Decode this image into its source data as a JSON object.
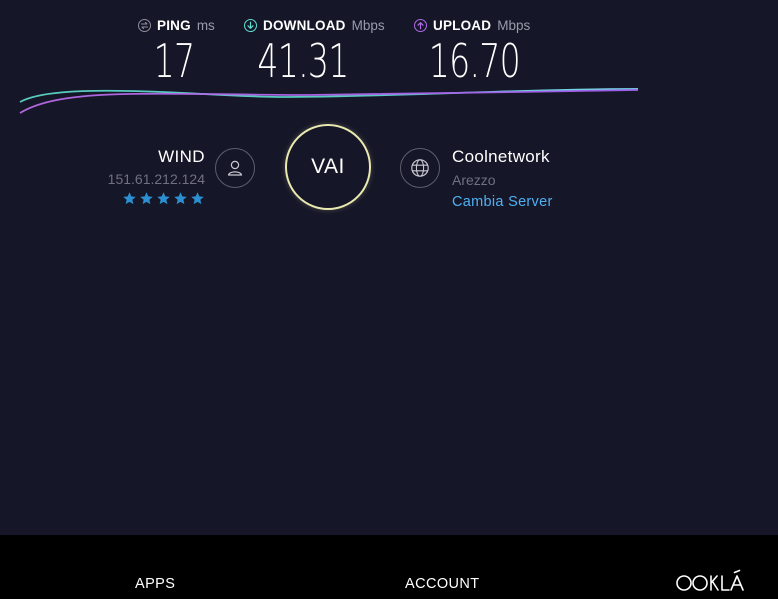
{
  "metrics": {
    "ping": {
      "label": "PING",
      "unit": "ms",
      "value": "17",
      "icon": "ping-icon"
    },
    "download": {
      "label": "DOWNLOAD",
      "unit": "Mbps",
      "value": "41.31",
      "icon": "download-arrow-icon"
    },
    "upload": {
      "label": "UPLOAD",
      "unit": "Mbps",
      "value": "16.70",
      "icon": "upload-arrow-icon"
    }
  },
  "isp": {
    "name": "WIND",
    "ip": "151.61.212.124",
    "rating": 5,
    "icon": "user-icon"
  },
  "go_button": {
    "label": "VAI"
  },
  "server": {
    "name": "Coolnetwork",
    "location": "Arezzo",
    "change_label": "Cambia Server",
    "icon": "globe-icon"
  },
  "footer": {
    "apps_label": "APPS",
    "account_label": "ACCOUNT",
    "logo_text": "OOKLA"
  },
  "colors": {
    "background": "#151627",
    "footer_background": "#000000",
    "download_line": "#5fdfd0",
    "upload_line": "#b06ae8",
    "star": "#2b8fd1",
    "link": "#4fb0f3",
    "go_ring": "#eaeab0"
  }
}
